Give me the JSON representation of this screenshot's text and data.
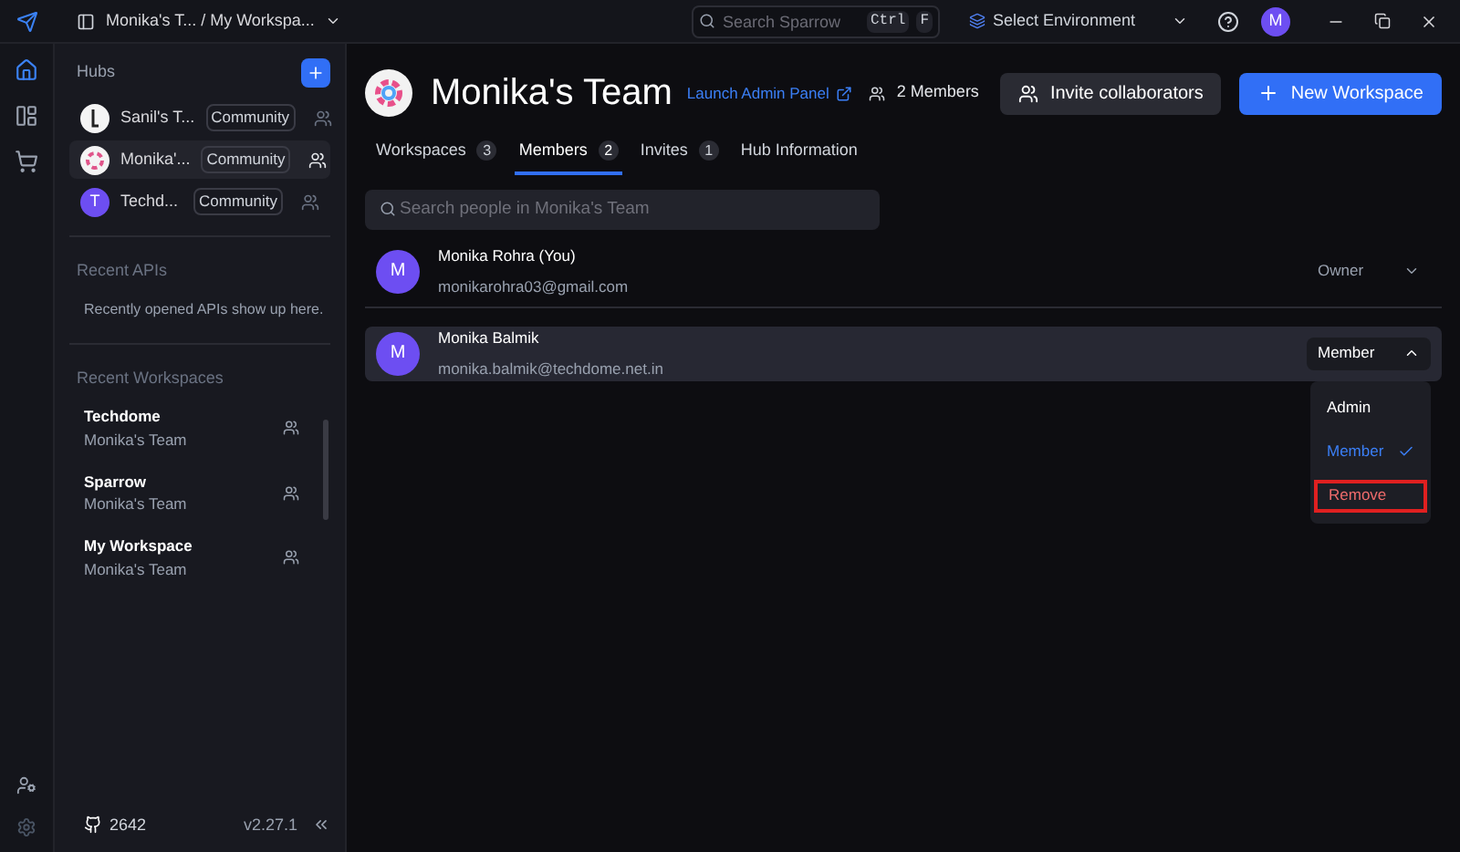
{
  "title_bar": {
    "breadcrumb": "Monika's T... / My Workspa...",
    "search_placeholder": "Search Sparrow",
    "shortcut_keys": [
      "Ctrl",
      "F"
    ],
    "environment": "Select Environment",
    "avatar": "M"
  },
  "rail": [
    {
      "kind": "home",
      "selected": true
    },
    {
      "kind": "layout",
      "selected": false
    },
    {
      "kind": "cart",
      "selected": false
    }
  ],
  "sidebar": {
    "hubs_title": "Hubs",
    "hubs": [
      {
        "name": "Sanil's T...",
        "badge": "Community",
        "selected": false,
        "avatar": {
          "kind": "mono"
        }
      },
      {
        "name": "Monika'...",
        "badge": "Community",
        "selected": true,
        "avatar": {
          "kind": "color"
        }
      },
      {
        "name": "Techd...",
        "badge": "Community",
        "selected": false,
        "avatar": {
          "kind": "letter",
          "letter": "T"
        }
      }
    ],
    "recent_apis_title": "Recent APIs",
    "recent_apis_empty": "Recently opened APIs show up here.",
    "recent_workspaces_title": "Recent Workspaces",
    "recent_workspaces": [
      {
        "name": "Techdome",
        "team": "Monika's Team"
      },
      {
        "name": "Sparrow",
        "team": "Monika's Team"
      },
      {
        "name": "My Workspace",
        "team": "Monika's Team"
      }
    ],
    "github_stars": "2642",
    "version": "v2.27.1"
  },
  "main": {
    "title": "Monika's Team",
    "admin_link": "Launch Admin Panel",
    "members_count": "2 Members",
    "invite_button": "Invite collaborators",
    "new_workspace_button": "New Workspace",
    "tabs": [
      {
        "label": "Workspaces",
        "count": "3",
        "selected": false
      },
      {
        "label": "Members",
        "count": "2",
        "selected": true
      },
      {
        "label": "Invites",
        "count": "1",
        "selected": false
      },
      {
        "label": "Hub Information",
        "selected": false
      }
    ],
    "search_placeholder": "Search people in Monika's Team",
    "members": [
      {
        "avatar": "M",
        "name": "Monika Rohra (You)",
        "email": "monikarohra03@gmail.com",
        "role": "Owner",
        "highlighted": false,
        "menu_open": false
      },
      {
        "avatar": "M",
        "name": "Monika Balmik",
        "email": "monika.balmik@techdome.net.in",
        "role": "Member",
        "highlighted": true,
        "menu_open": true
      }
    ],
    "role_menu": [
      {
        "label": "Admin",
        "selected": false,
        "kind": "role",
        "outlined": false
      },
      {
        "label": "Member",
        "selected": true,
        "kind": "role",
        "outlined": false
      },
      {
        "label": "Remove",
        "selected": false,
        "kind": "danger",
        "outlined": true
      }
    ]
  }
}
